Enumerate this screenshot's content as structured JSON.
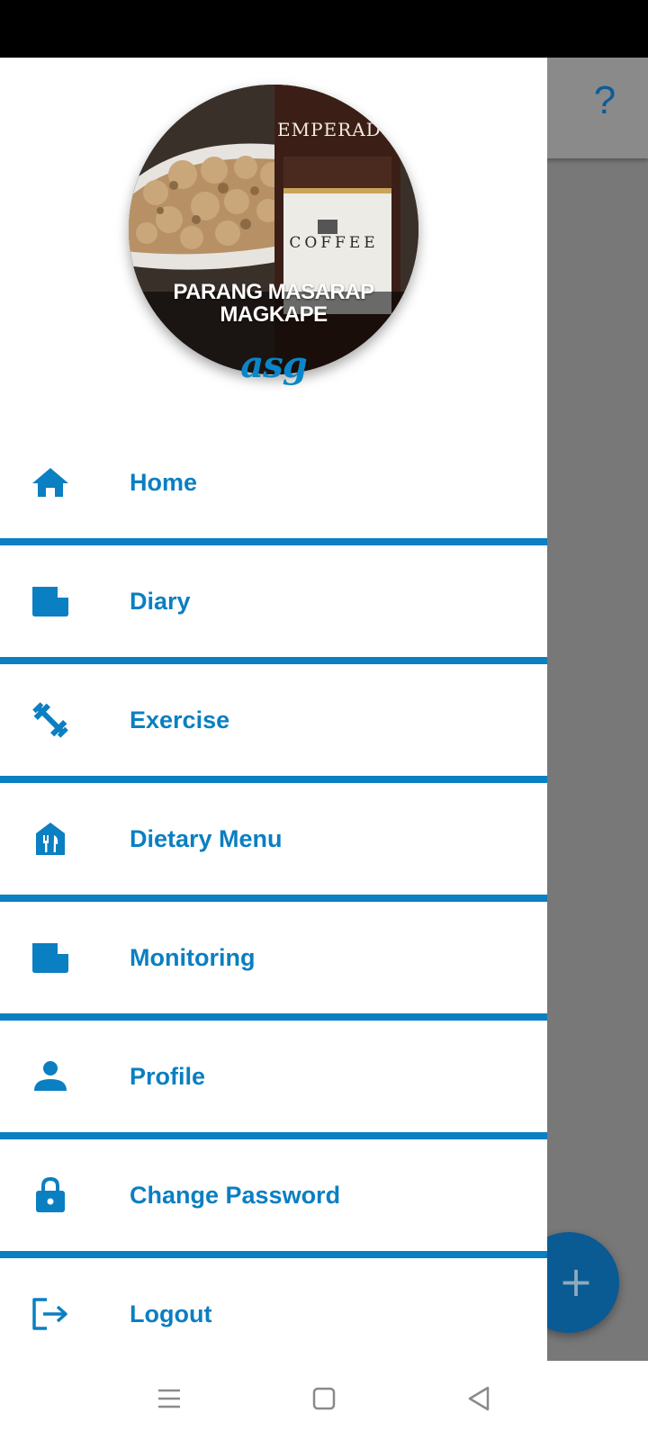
{
  "header": {
    "help_icon": "help-icon",
    "help_glyph": "?"
  },
  "profile": {
    "avatar_caption_line1": "PARANG MASARAP",
    "avatar_caption_line2": "MAGKAPE",
    "bottle_brand": "EMPERADOR",
    "bottle_label": "COFFEE",
    "username": "asg"
  },
  "menu": {
    "items": [
      {
        "label": "Home",
        "icon": "home-icon"
      },
      {
        "label": "Diary",
        "icon": "note-icon"
      },
      {
        "label": "Exercise",
        "icon": "dumbbell-icon"
      },
      {
        "label": "Dietary Menu",
        "icon": "restaurant-icon"
      },
      {
        "label": "Monitoring",
        "icon": "note-icon"
      },
      {
        "label": "Profile",
        "icon": "person-icon"
      },
      {
        "label": "Change Password",
        "icon": "lock-icon"
      },
      {
        "label": "Logout",
        "icon": "logout-icon"
      }
    ]
  },
  "fab": {
    "icon": "plus-icon",
    "glyph": "+"
  },
  "system_nav": {
    "buttons": [
      "menu-icon",
      "home-square-icon",
      "back-triangle-icon"
    ]
  },
  "colors": {
    "accent": "#0a7fc2",
    "scrim": "#787878",
    "drawer_background": "#ffffff"
  }
}
